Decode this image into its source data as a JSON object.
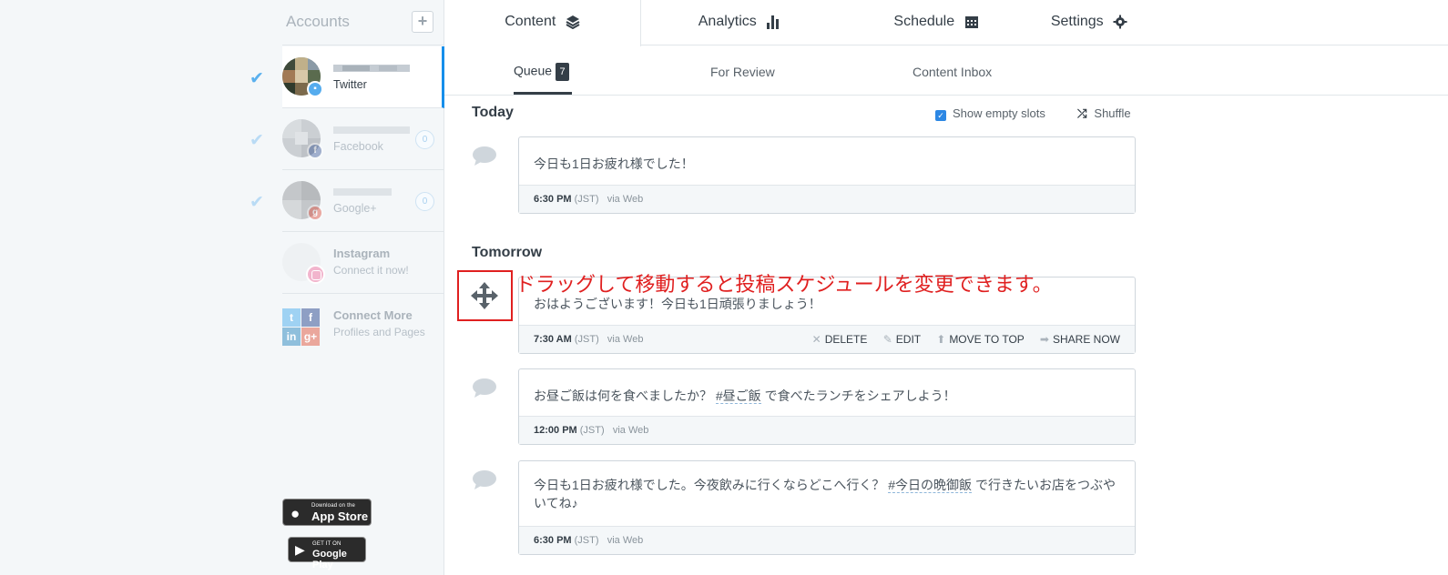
{
  "sidebar": {
    "title": "Accounts",
    "add_symbol": "+",
    "accounts": [
      {
        "network": "Twitter",
        "count": ""
      },
      {
        "network": "Facebook",
        "count": "0"
      },
      {
        "network": "Google+",
        "count": "0"
      }
    ],
    "instagram": {
      "title": "Instagram",
      "subtitle": "Connect it now!"
    },
    "connect_more": {
      "title": "Connect More",
      "subtitle": "Profiles and Pages"
    },
    "app_store": {
      "small": "Download on the",
      "big": "App Store"
    },
    "google_play": {
      "small": "GET IT ON",
      "big": "Google Play"
    }
  },
  "top_tabs": [
    {
      "label": "Content",
      "icon": "layers-icon"
    },
    {
      "label": "Analytics",
      "icon": "bar-chart-icon"
    },
    {
      "label": "Schedule",
      "icon": "calendar-icon"
    },
    {
      "label": "Settings",
      "icon": "gear-icon"
    }
  ],
  "sub_tabs": {
    "queue": "Queue",
    "queue_count": "7",
    "for_review": "For Review",
    "content_inbox": "Content Inbox"
  },
  "queue": {
    "show_empty_slots": "Show empty slots",
    "shuffle": "Shuffle",
    "today_label": "Today",
    "tomorrow_label": "Tomorrow",
    "via": "via Web",
    "tz": "(JST)",
    "posts": [
      {
        "text": "今日も1日お疲れ様でした！",
        "time": "6:30 PM"
      },
      {
        "text": "おはようございます！今日も1日頑張りましょう！",
        "time": "7:30 AM"
      },
      {
        "text_before": "お昼ご飯は何を食べましたか？ ",
        "hashtag": "#昼ご飯",
        "text_after": " で食べたランチをシェアしよう！",
        "time": "12:00 PM"
      },
      {
        "text_before": "今日も1日お疲れ様でした。今夜飲みに行くならどこへ行く？ ",
        "hashtag": "#今日の晩御飯",
        "text_after": " で行きたいお店をつぶやいてね♪",
        "time": "6:30 PM"
      }
    ],
    "actions": {
      "delete": "DELETE",
      "edit": "EDIT",
      "move_to_top": "MOVE TO TOP",
      "share_now": "SHARE NOW"
    }
  },
  "annotation": "ドラッグして移動すると投稿スケジュールを変更できます。",
  "colors": {
    "accent": "#168eea",
    "annotation": "#e02020",
    "text": "#343e47"
  }
}
